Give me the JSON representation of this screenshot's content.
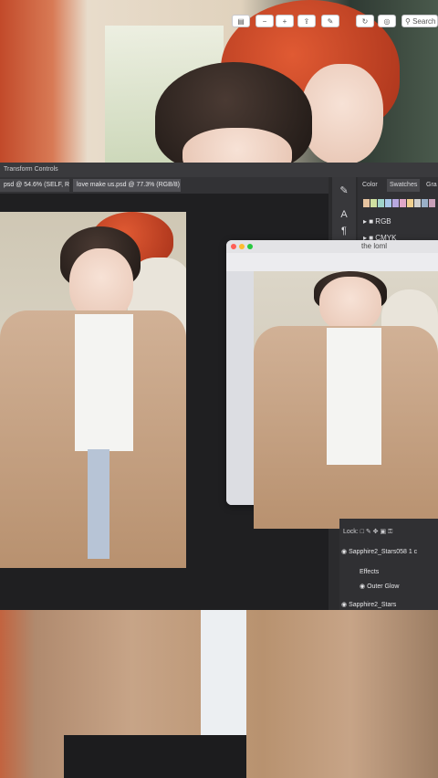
{
  "photoshop": {
    "top_bar_label": "Transform Controls",
    "tabs": [
      {
        "label": "psd @ 54.6% (SELF, RGB/8)"
      },
      {
        "label": "love make us.psd @ 77.3% (RGB/8)"
      }
    ],
    "tools": [
      {
        "icon": "pen-tool-icon",
        "glyph": "✎"
      },
      {
        "icon": "type-tool-icon",
        "glyph": "A"
      },
      {
        "icon": "paragraph-icon",
        "glyph": "¶"
      }
    ],
    "color_panel": {
      "tabs": [
        {
          "label": "Color"
        },
        {
          "label": "Swatches"
        },
        {
          "label": "Gra"
        }
      ],
      "swatch_colors": [
        "#e7c4a0",
        "#cfe0a0",
        "#9fd3c9",
        "#a8c6e8",
        "#b8a8e0",
        "#e0a8c8",
        "#f0d090",
        "#d0d0d0",
        "#9ab0c8",
        "#c8a0b8"
      ],
      "folders": [
        {
          "label": "RGB"
        },
        {
          "label": "CMYK"
        }
      ]
    },
    "layers_panel": {
      "lock_label": "Lock:",
      "rows": [
        {
          "label": "Sapphire2_Stars058 1 c"
        },
        {
          "label": "Effects"
        },
        {
          "label": "Outer Glow"
        },
        {
          "label": "Sapphire2_Stars"
        }
      ]
    }
  },
  "preview_window": {
    "title": "the loml",
    "toolbar_buttons": [
      {
        "icon": "sidebar-toggle-icon",
        "glyph": "▤"
      },
      {
        "icon": "zoom-out-icon",
        "glyph": "−"
      },
      {
        "icon": "zoom-in-icon",
        "glyph": "+"
      },
      {
        "icon": "share-icon",
        "glyph": "⇪"
      },
      {
        "icon": "markup-icon",
        "glyph": "✎"
      },
      {
        "icon": "rotate-icon",
        "glyph": "↻"
      },
      {
        "icon": "annotate-icon",
        "glyph": "◎"
      }
    ],
    "search_label": "Search"
  }
}
